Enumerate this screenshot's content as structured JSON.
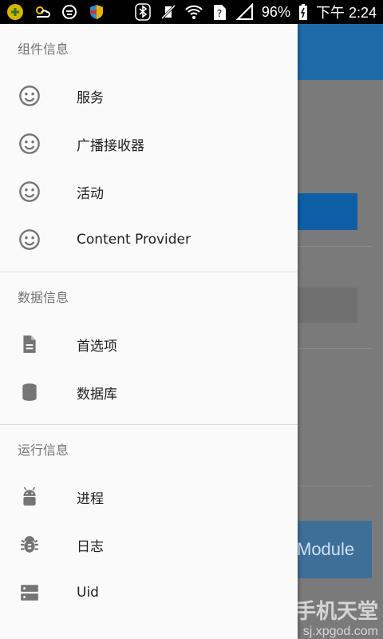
{
  "status_bar": {
    "battery": "96%",
    "time": "下午 2:24"
  },
  "drawer": {
    "sections": [
      {
        "header": "组件信息",
        "items": [
          {
            "label": "服务",
            "icon": "smiley-icon"
          },
          {
            "label": "广播接收器",
            "icon": "smiley-icon"
          },
          {
            "label": "活动",
            "icon": "smiley-icon"
          },
          {
            "label": "Content Provider",
            "icon": "smiley-icon"
          }
        ]
      },
      {
        "header": "数据信息",
        "items": [
          {
            "label": "首选项",
            "icon": "document-icon"
          },
          {
            "label": "数据库",
            "icon": "database-icon"
          }
        ]
      },
      {
        "header": "运行信息",
        "items": [
          {
            "label": "进程",
            "icon": "android-icon"
          },
          {
            "label": "日志",
            "icon": "bug-icon"
          },
          {
            "label": "Uid",
            "icon": "server-icon"
          }
        ]
      }
    ]
  },
  "background": {
    "module_button_label": "Module"
  },
  "watermark": {
    "title": "手机天堂",
    "url": "sj.xpgod.com"
  },
  "colors": {
    "toolbar": "#1f6aa8",
    "drawer_bg": "#fafafa",
    "icon": "#757575"
  }
}
